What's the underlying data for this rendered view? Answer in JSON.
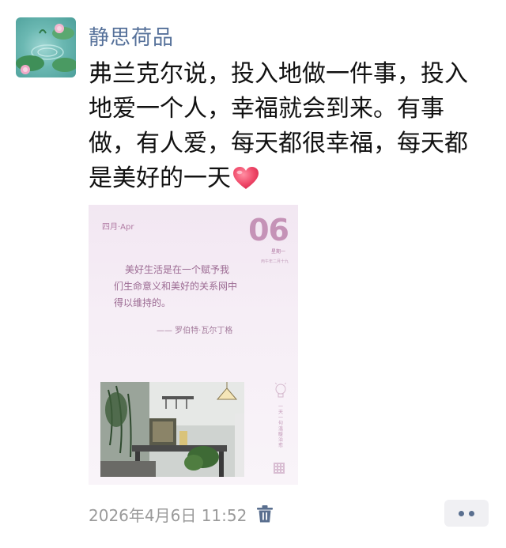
{
  "post": {
    "author_name": "静思荷品",
    "text_lines": [
      "弗兰克尔说，投入地做一件事，投入",
      "地爱一个人，幸福就会到来。有事",
      "做，有人爱，每天都很幸福，每天都",
      "是美好的一天"
    ],
    "emoji": "heart-emoji",
    "timestamp": "2026年4月6日 11:52"
  },
  "card": {
    "month": "四月·Apr",
    "day": "06",
    "weekday": "星期一",
    "lunar": "丙午年二月十九",
    "quote_lines": [
      "美好生活是在一个赋予我",
      "们生命意义和美好的关系网中",
      "得以维持的。"
    ],
    "author": "—— 罗伯特·瓦尔丁格",
    "side_text": "一天一句温暖治愈"
  },
  "colors": {
    "author_link": "#56719a",
    "timestamp": "#9a9a9a",
    "card_accent": "#c593b7"
  },
  "icons": [
    "lotus-avatar",
    "heart-emoji",
    "trash-icon",
    "more-dots-icon",
    "bulb-icon",
    "qr-code-icon"
  ]
}
